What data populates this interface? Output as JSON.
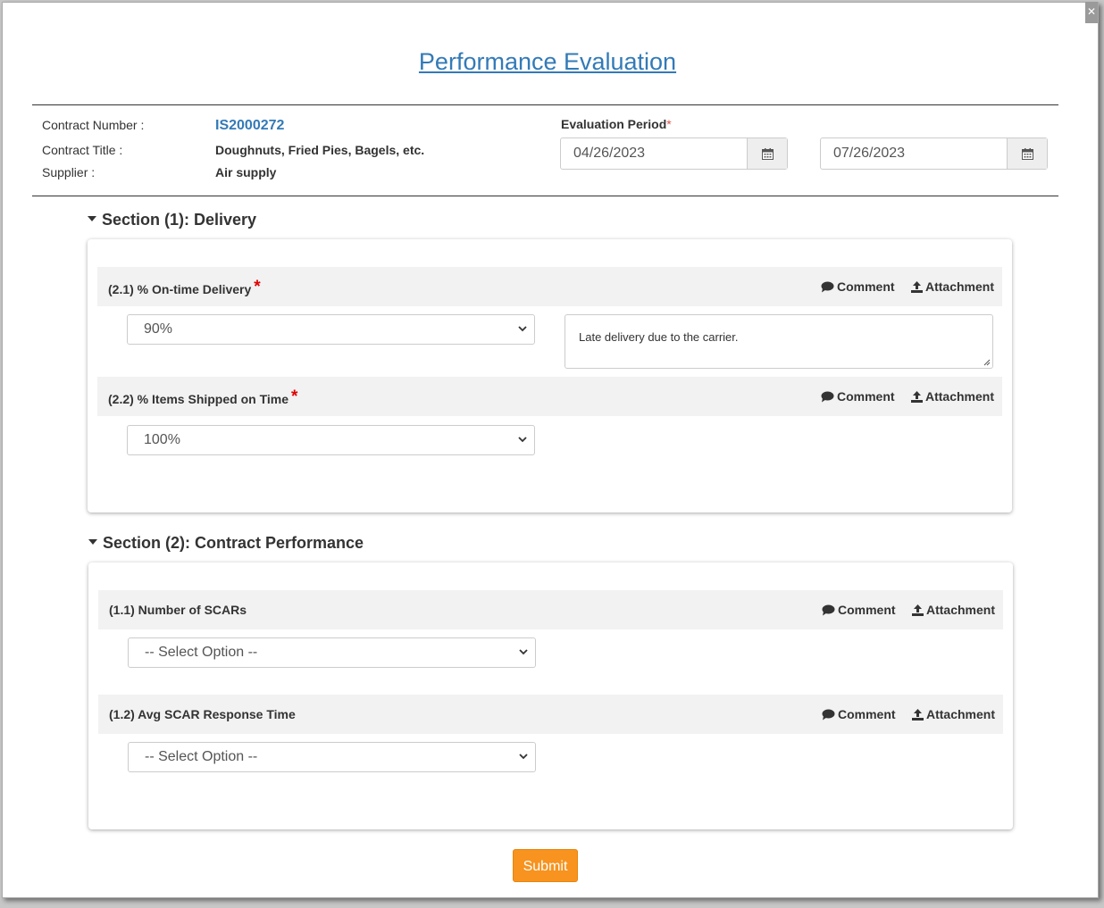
{
  "title": "Performance Evaluation",
  "contract": {
    "number_label": "Contract Number :",
    "number": "IS2000272",
    "title_label": "Contract Title :",
    "title": "Doughnuts, Fried Pies, Bagels, etc.",
    "supplier_label": "Supplier :",
    "supplier": "Air supply"
  },
  "evaluation_period": {
    "label": "Evaluation Period",
    "required_mark": "*",
    "start": "04/26/2023",
    "end": "07/26/2023"
  },
  "actions": {
    "comment": "Comment",
    "attachment": "Attachment"
  },
  "sections": [
    {
      "title": "Section (1): Delivery",
      "questions": [
        {
          "label": "(2.1) % On-time Delivery",
          "required": "*",
          "value": "90%",
          "comment": "Late delivery due to the carrier."
        },
        {
          "label": "(2.2) % Items Shipped on Time",
          "required": "*",
          "value": "100%"
        }
      ]
    },
    {
      "title": "Section (2): Contract Performance",
      "questions": [
        {
          "label": "(1.1) Number of SCARs",
          "value": "-- Select Option --"
        },
        {
          "label": "(1.2) Avg SCAR Response Time",
          "value": "-- Select Option --"
        }
      ]
    }
  ],
  "submit_label": "Submit",
  "icons": {
    "calendar": "calendar-icon",
    "comment": "comment-icon",
    "upload": "upload-icon",
    "chevron": "chevron-down-icon",
    "caret": "caret-down-icon"
  },
  "colors": {
    "link": "#337ab7",
    "submit": "#f7931e",
    "required": "#e00000"
  }
}
